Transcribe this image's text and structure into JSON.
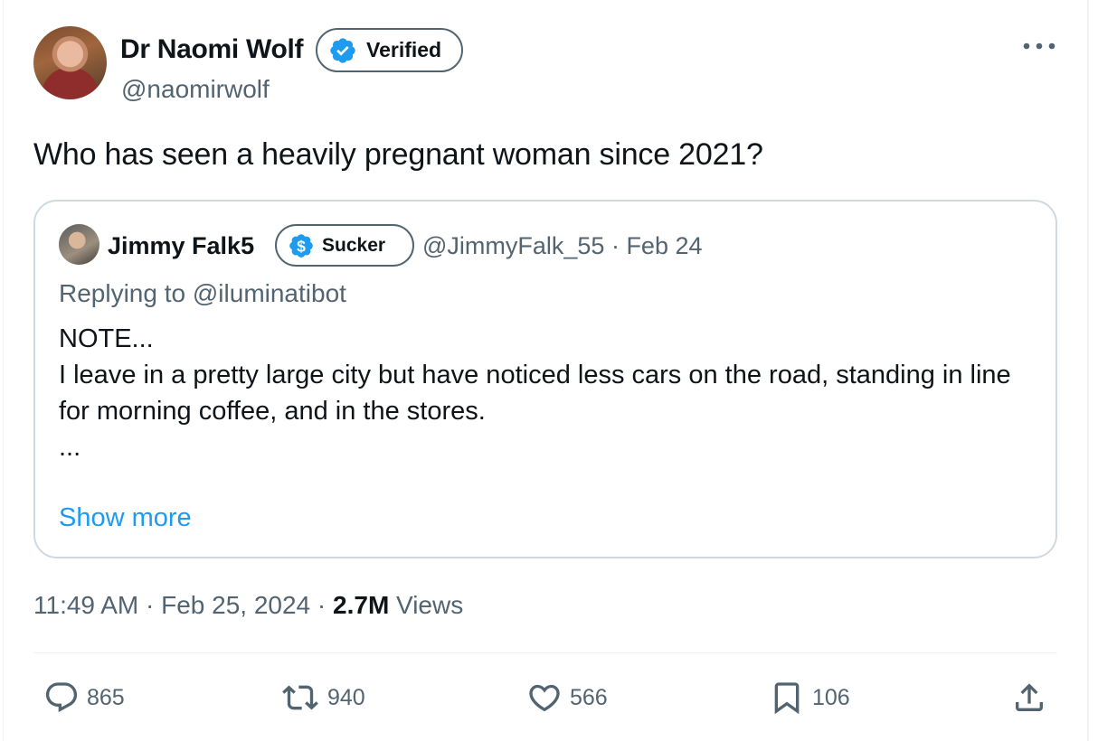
{
  "author": {
    "name": "Dr Naomi Wolf",
    "badge": "Verified",
    "handle": "@naomirwolf"
  },
  "tweet": {
    "text": "Who has seen a heavily pregnant woman since 2021?"
  },
  "quoted": {
    "name": "Jimmy Falk5",
    "badge": "Sucker",
    "handle_date": "@JimmyFalk_55 · Feb 24",
    "replying_prefix": "Replying to ",
    "replying_to": "@iluminatibot",
    "body_lines": [
      "NOTE...",
      "",
      "I leave in a pretty large city but have noticed less cars on the road, standing in line for morning coffee, and in the stores.",
      "..."
    ],
    "show_more": "Show more"
  },
  "meta": {
    "time_date": "11:49 AM · Feb 25, 2024 · ",
    "views_count": "2.7M",
    "views_label": " Views"
  },
  "actions": {
    "replies": "865",
    "reposts": "940",
    "likes": "566",
    "bookmarks": "106"
  },
  "colors": {
    "text_primary": "#0f1419",
    "text_secondary": "#536471",
    "accent_blue": "#1d9bf0",
    "border": "#cfd9de"
  },
  "icons": [
    "more-icon",
    "verified-badge-icon",
    "dollar-badge-icon",
    "reply-icon",
    "repost-icon",
    "like-icon",
    "bookmark-icon",
    "share-icon"
  ]
}
